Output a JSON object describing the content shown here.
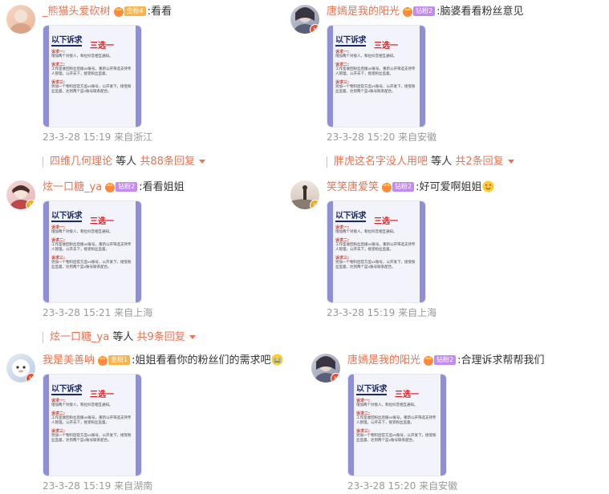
{
  "comments": [
    {
      "username": "_熊猫头爱砍树",
      "fan_level": "金粉4",
      "fan_color": "gold",
      "text": "看看",
      "emoji": "",
      "badge": "v",
      "timestamp": "23-3-28 15:19",
      "location": "来自浙江",
      "replies": {
        "user": "四维几何理论",
        "label": "等人",
        "count": "共88条回复"
      }
    },
    {
      "username": "唐嫣是我的阳光",
      "fan_level": "钻粉2",
      "fan_color": "purple",
      "text": "脑婆看看粉丝意见",
      "emoji": "",
      "badge": "v-red",
      "timestamp": "23-3-28 15:20",
      "location": "来自安徽",
      "replies": {
        "user": "胖虎这名字没人用吧",
        "label": "等人",
        "count": "共2条回复"
      }
    },
    {
      "username": "炫一口糖_ya",
      "fan_level": "钻粉2",
      "fan_color": "purple",
      "text": "看看姐姐",
      "emoji": "",
      "badge": "v",
      "timestamp": "23-3-28 15:21",
      "location": "来自上海",
      "replies": {
        "user": "炫一口糖_ya",
        "label": "等人",
        "count": "共9条回复"
      }
    },
    {
      "username": "笑笑唐爱笑",
      "fan_level": "钻粉2",
      "fan_color": "purple",
      "text": "好可爱啊姐姐",
      "emoji": "heart-eyes-emoji",
      "badge": "v",
      "timestamp": "23-3-28 15:19",
      "location": "来自上海",
      "replies": null
    },
    {
      "username": "我是美善呐",
      "fan_level": "金粉1",
      "fan_color": "gold",
      "text": "姐姐看看你的粉丝们的需求吧",
      "emoji": "crying-emoji",
      "badge": "v-red",
      "timestamp": "23-3-28 15:19",
      "location": "来自湖南",
      "replies": null
    },
    {
      "username": "唐嫣是我的阳光",
      "fan_level": "钻粉2",
      "fan_color": "purple",
      "text": "合理诉求帮帮我们",
      "emoji": "",
      "badge": "v-red",
      "timestamp": "23-3-28 15:20",
      "location": "来自安徽",
      "replies": null
    }
  ],
  "thumbnail": {
    "title": "以下诉求",
    "subtitle": "三选一",
    "h1": "诉求一:",
    "p1": "增加两个对接人，和拉抖音相互通知。",
    "h2": "诉求二:",
    "p2": "工作室收回粉丝后援vs账号，重新公开筛选支持专人管理，公开去下，接受粉丝监督。",
    "h3": "诉求三:",
    "p3": "另加一个物料团官方监vs账号，公开发下，接受粉丝监督，达到两个蓝v账号联系配合。"
  },
  "colors": {
    "accent": "#eb7350",
    "meta": "#999999",
    "gold_badge": "#ffb347",
    "purple_badge": "#c38af0"
  }
}
